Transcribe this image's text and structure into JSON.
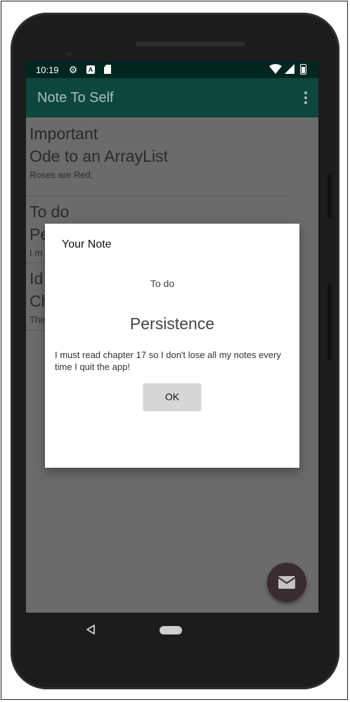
{
  "status_bar": {
    "time": "10:19",
    "icons": [
      "gear-icon",
      "a-notification-icon",
      "sd-card-icon",
      "wifi-icon",
      "cell-signal-icon",
      "battery-icon"
    ]
  },
  "app_bar": {
    "title": "Note To Self",
    "menu_icon": "overflow-menu-icon"
  },
  "notes": [
    {
      "status": "Important",
      "title": "Ode to an ArrayList",
      "description": "Roses are Red,"
    },
    {
      "status": "To do",
      "title": "Pe",
      "description": "I m"
    },
    {
      "status": "Id",
      "title": "Ch",
      "description": "The"
    }
  ],
  "dialog": {
    "title": "Your Note",
    "status": "To do",
    "heading": "Persistence",
    "body": "I must read chapter 17 so I don't lose all my notes every time I quit the app!",
    "ok_label": "OK"
  },
  "fab": {
    "icon": "email-icon"
  },
  "nav_bar": {
    "back_icon": "back-triangle-icon",
    "home_icon": "home-pill-icon"
  },
  "colors": {
    "status_bar": "#002620",
    "app_bar": "#0d463c",
    "scrim_background": "#6b6b6b",
    "fab": "#3a2c31",
    "dialog": "#ffffff"
  }
}
